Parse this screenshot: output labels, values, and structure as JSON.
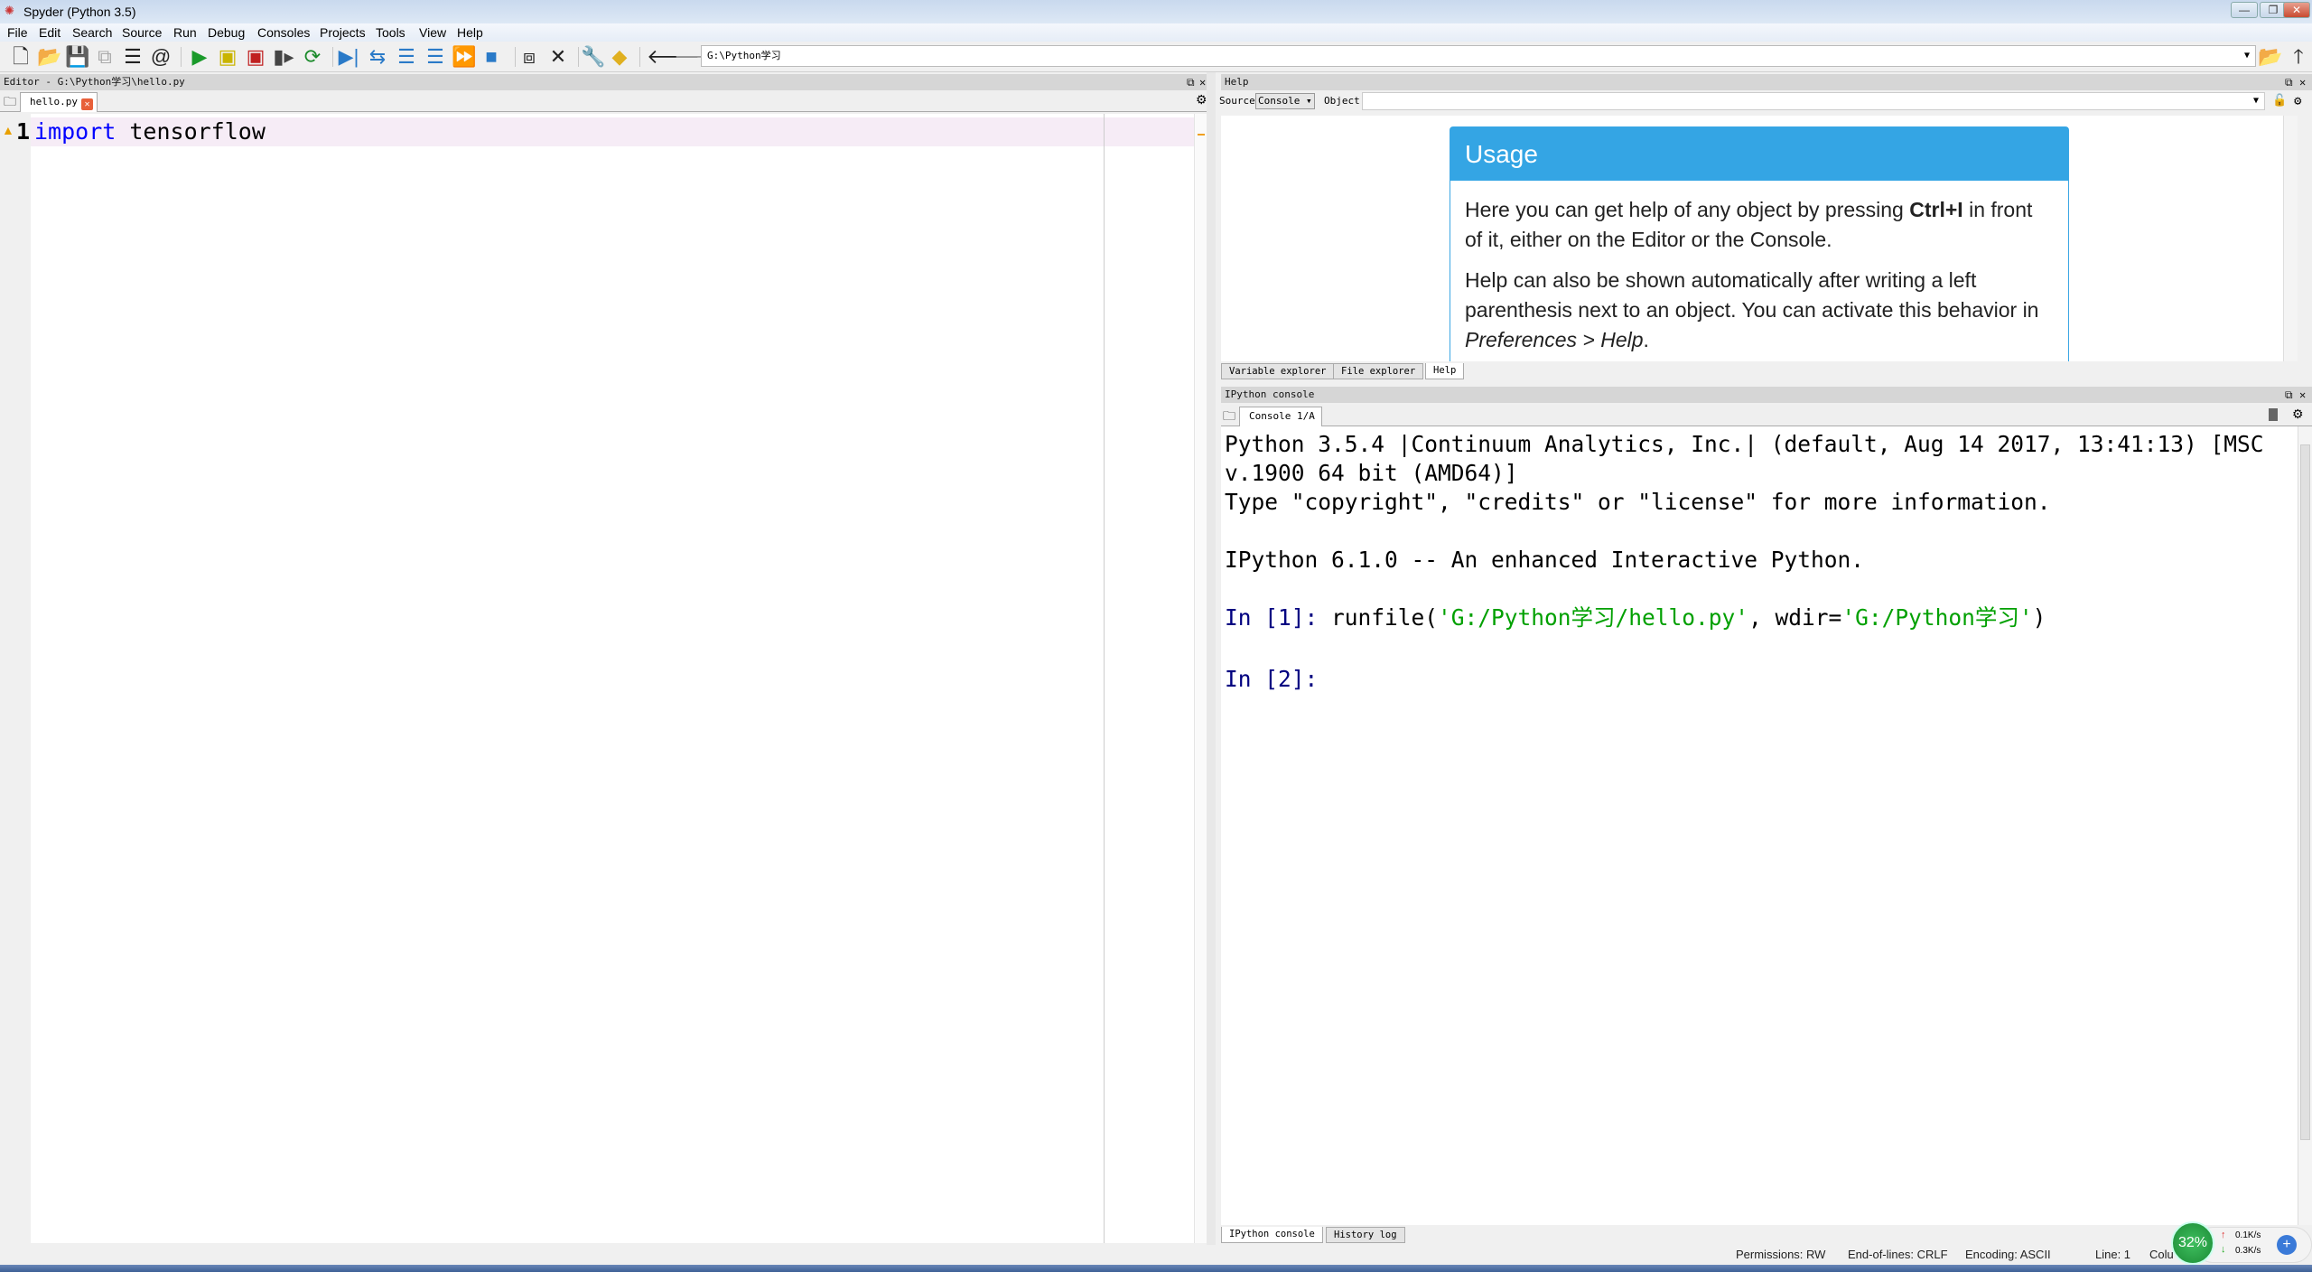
{
  "window": {
    "title": "Spyder (Python 3.5)",
    "minimize": "—",
    "restore": "❐",
    "close": "✕"
  },
  "menu": [
    "File",
    "Edit",
    "Search",
    "Source",
    "Run",
    "Debug",
    "Consoles",
    "Projects",
    "Tools",
    "View",
    "Help"
  ],
  "toolbar": {
    "icons": [
      "new-file",
      "open-file",
      "save-file",
      "save-all",
      "outline",
      "at-symbol",
      "run",
      "run-cell",
      "run-cell-advance",
      "run-selection",
      "rerun",
      "debug",
      "debug-step",
      "debug-step-into",
      "debug-step-return",
      "debug-continue",
      "debug-stop",
      "maximize-pane",
      "fullscreen",
      "preferences-wrench",
      "python-path",
      "back-arrow",
      "forward-arrow",
      "browse-folder",
      "parent-directory"
    ],
    "path": "G:\\Python学习"
  },
  "editor": {
    "header": "Editor - G:\\Python学习\\hello.py",
    "tab": "hello.py",
    "lines": [
      {
        "number": "1",
        "keyword": "import",
        "rest": " tensorflow",
        "warning": true
      }
    ]
  },
  "help": {
    "header": "Help",
    "source_label": "Source",
    "source_value": "Console",
    "object_label": "Object",
    "object_value": "",
    "usage_title": "Usage",
    "p1_a": "Here you can get help of any object by pressing ",
    "p1_bold": "Ctrl+I",
    "p1_b": " in front of it, either on the Editor or the Console.",
    "p2_a": "Help can also be shown automatically after writing a left parenthesis next to an object. You can activate this behavior in ",
    "p2_italic": "Preferences > Help",
    "p2_b": ".",
    "tabs": [
      "Variable explorer",
      "File explorer",
      "Help"
    ],
    "active_tab": "Help"
  },
  "console": {
    "header": "IPython console",
    "tab": "Console 1/A",
    "banner1": "Python 3.5.4 |Continuum Analytics, Inc.| (default, Aug 14 2017, 13:41:13) [MSC",
    "banner2": "v.1900 64 bit (AMD64)]",
    "banner3": "Type \"copyright\", \"credits\" or \"license\" for more information.",
    "banner4": "IPython 6.1.0 -- An enhanced Interactive Python.",
    "in1_prompt": "In [1]: ",
    "in1_fn": "runfile(",
    "in1_s1": "'G:/Python学习/hello.py'",
    "in1_mid": ", wdir=",
    "in1_s2": "'G:/Python学习'",
    "in1_end": ")",
    "in2_prompt": "In [2]:",
    "tabs": [
      "IPython console",
      "History log"
    ],
    "active_tab": "IPython console"
  },
  "status": {
    "permissions": "Permissions: RW",
    "eol": "End-of-lines: CRLF",
    "encoding": "Encoding: ASCII",
    "line": "Line: 1",
    "column": "Colu",
    "memory": "%"
  },
  "overlay": {
    "cpu": "32%",
    "up": "0.1K/s",
    "down": "0.3K/s"
  },
  "colors": {
    "keyword": "#0000ff",
    "prompt": "#000080",
    "string": "#00a000",
    "usage_header": "#34a5e4"
  }
}
